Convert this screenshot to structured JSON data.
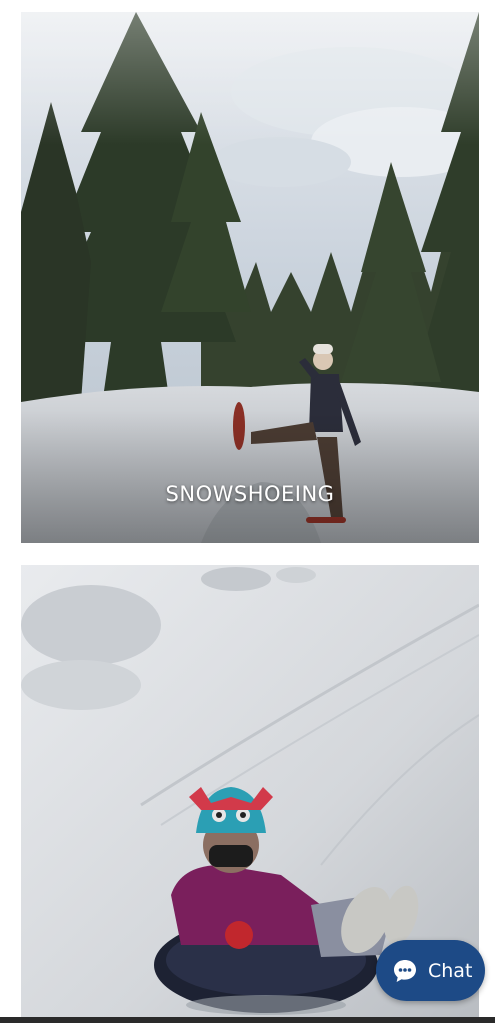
{
  "activities": [
    {
      "caption": "SNOWSHOEING",
      "image": "snowshoeing-photo"
    },
    {
      "caption": "",
      "image": "snow-tubing-photo"
    }
  ],
  "chat": {
    "label": "Chat",
    "icon": "chat-bubble-icon",
    "color": "#1d4a86"
  }
}
